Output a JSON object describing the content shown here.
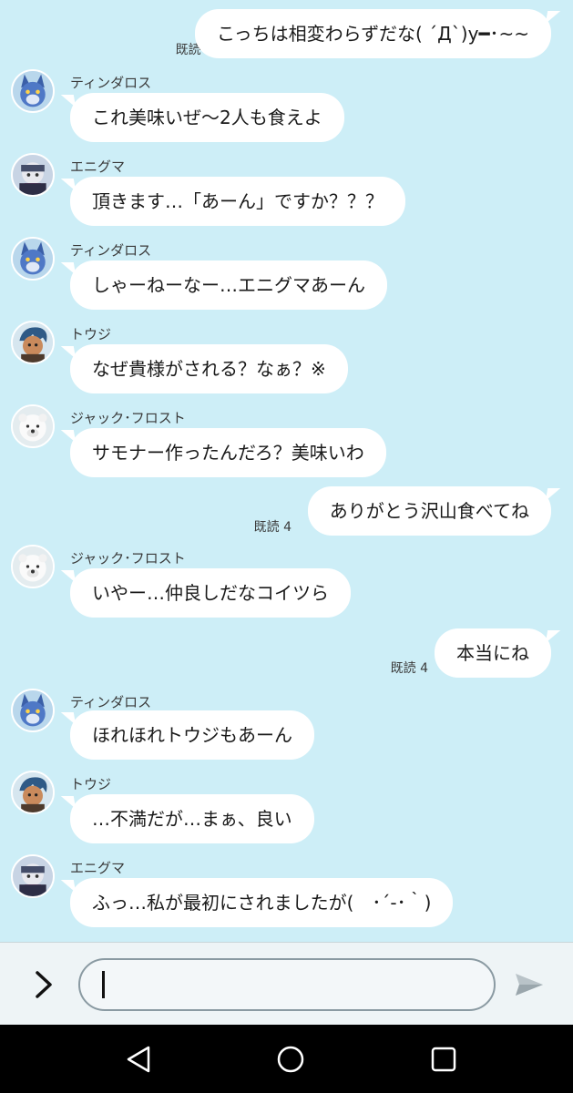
{
  "messages": [
    {
      "side": "out",
      "text": "こっちは相変わらずだな( ´Д`)y━･~~",
      "read": "既読 4"
    },
    {
      "side": "in",
      "sender": "ティンダロス",
      "avatar": "tindalos-avatar",
      "text": "これ美味いぜ〜2人も食えよ"
    },
    {
      "side": "in",
      "sender": "エニグマ",
      "avatar": "enigma-avatar",
      "text": "頂きます…「あーん」ですか？？？"
    },
    {
      "side": "in",
      "sender": "ティンダロス",
      "avatar": "tindalos-avatar",
      "text": "しゃーねーなー…エニグマあーん"
    },
    {
      "side": "in",
      "sender": "トウジ",
      "avatar": "touji-avatar",
      "text": "なぜ貴様がされる？なぁ？※"
    },
    {
      "side": "in",
      "sender": "ジャック･フロスト",
      "avatar": "jackfrost-avatar",
      "text": "サモナー作ったんだろ？美味いわ"
    },
    {
      "side": "out",
      "text": "ありがとう沢山食べてね",
      "read": "既読 4"
    },
    {
      "side": "in",
      "sender": "ジャック･フロスト",
      "avatar": "jackfrost-avatar",
      "text": "いやー…仲良しだなコイツら"
    },
    {
      "side": "out",
      "text": "本当にね",
      "read": "既読 4"
    },
    {
      "side": "in",
      "sender": "ティンダロス",
      "avatar": "tindalos-avatar",
      "text": "ほれほれトウジもあーん"
    },
    {
      "side": "in",
      "sender": "トウジ",
      "avatar": "touji-avatar",
      "text": "…不満だが…まぁ、良い"
    },
    {
      "side": "in",
      "sender": "エニグマ",
      "avatar": "enigma-avatar",
      "text": "ふっ…私が最初にされましたが(　･´-･｀)"
    }
  ],
  "composer": {
    "placeholder": "",
    "value": ""
  },
  "icons": {
    "expand": "chevron-right-icon",
    "send": "send-icon",
    "back": "back-triangle-icon",
    "home": "home-circle-icon",
    "recents": "recents-square-icon"
  },
  "colors": {
    "chat_background": "#cdeef7",
    "bubble": "#ffffff",
    "navbar": "#000000"
  }
}
